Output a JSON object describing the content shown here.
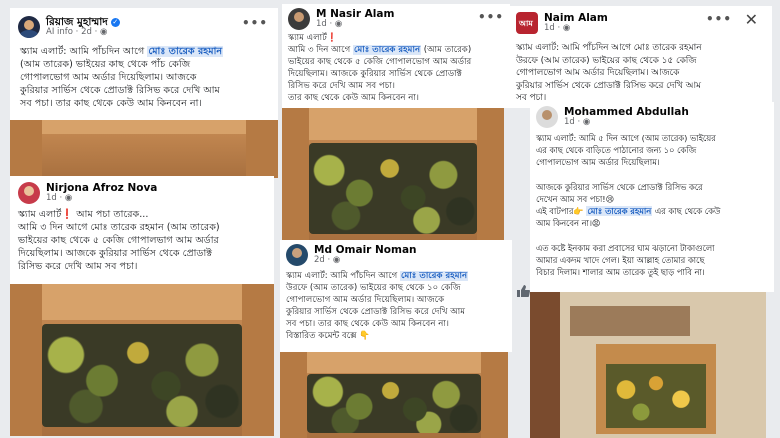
{
  "posts": {
    "p1": {
      "author": "রিয়াজ মুহাম্মাদ",
      "verified": true,
      "source": "AI info",
      "time": "2d",
      "lines": [
        {
          "pre": "স্ক্যাম এলার্ট: আমি পাঁচদিন আগে ",
          "hl": "মোঃ তারেক রহমান",
          "post": ""
        },
        {
          "pre": "(আম তারেক) ভাইয়ের কাছ থেকে পাঁচ কেজি",
          "hl": "",
          "post": ""
        },
        {
          "pre": "গোপালভোগ আম অর্ডার দিয়েছিলাম। আজকে",
          "hl": "",
          "post": ""
        },
        {
          "pre": "কুরিয়ার সার্ভিস থেকে প্রোডাক্ট রিসিভ করে দেখি আম",
          "hl": "",
          "post": ""
        },
        {
          "pre": "সব পচা। তার কাছ থেকে কেউ আম কিনবেন না।",
          "hl": "",
          "post": ""
        }
      ]
    },
    "p2": {
      "author": "Nirjona Afroz Nova",
      "time": "1d",
      "lines": [
        {
          "pre": "স্ক্যাম এলার্ট❗ আম পচা তারেক...",
          "hl": "",
          "post": ""
        },
        {
          "pre": "আমি ৩ দিন আগে মোঃ তারেক রহমান (আম তারেক)",
          "hl": "",
          "post": ""
        },
        {
          "pre": "ভাইয়ের কাছ থেকে ৫ কেজি গোপালভাগ আম অর্ডার",
          "hl": "",
          "post": ""
        },
        {
          "pre": "দিয়েছিলাম। আজকে কুরিয়ার সার্ভিস থেকে প্রোডাক্ট",
          "hl": "",
          "post": ""
        },
        {
          "pre": "রিসিভ করে দেখি আম সব পচা।",
          "hl": "",
          "post": ""
        }
      ]
    },
    "p3": {
      "author": "M Nasir Alam",
      "time": "1d",
      "lines": [
        {
          "pre": "স্ক্যাম এলার্ট❗",
          "hl": "",
          "post": ""
        },
        {
          "pre": "আমি ৩ দিন আগে ",
          "hl": "মোঃ তারেক রহমান",
          "post": " (আম তারেক)"
        },
        {
          "pre": "ভাইয়ের কাছ থেকে ৫ কেজি গোপালভোগ আম অর্ডার",
          "hl": "",
          "post": ""
        },
        {
          "pre": "দিয়েছিলাম। আজকে কুরিয়ার সার্ভিস থেকে প্রোডাক্ট",
          "hl": "",
          "post": ""
        },
        {
          "pre": "রিসিভ করে দেখি আম সব পচা।",
          "hl": "",
          "post": ""
        },
        {
          "pre": "তার কাছ থেকে কেউ আম কিনবেন না।",
          "hl": "",
          "post": ""
        }
      ]
    },
    "p4": {
      "author": "Md Omair Noman",
      "time": "2d",
      "lines": [
        {
          "pre": "স্ক্যাম এলার্ট: আমি পাঁচদিন আগে ",
          "hl": "মোঃ তারেক রহমান",
          "post": ""
        },
        {
          "pre": "উরফে (আম তারেক) ভাইয়ের কাছ থেকে ১০ কেজি",
          "hl": "",
          "post": ""
        },
        {
          "pre": "গোপালভোগ আম অর্ডার দিয়েছিলাম। আজকে",
          "hl": "",
          "post": ""
        },
        {
          "pre": "কুরিয়ার সার্ভিস থেকে প্রোডাক্ট রিসিভ করে দেখি আম",
          "hl": "",
          "post": ""
        },
        {
          "pre": "সব পচা। তার কাছ থেকে কেউ আম কিনবেন না।",
          "hl": "",
          "post": ""
        },
        {
          "pre": "বিস্তারিত কমেন্ট বক্সে 👇",
          "hl": "",
          "post": ""
        }
      ]
    },
    "p5": {
      "author": "Naim Alam",
      "time": "1d",
      "lines": [
        {
          "pre": "স্ক্যাম এলার্ট: আমি পাঁচদিন আগে মোঃ তারেক রহমান",
          "hl": "",
          "post": ""
        },
        {
          "pre": "উরফে (আম তারেক) ভাইয়ের কাছ থেকে ১৫ কেজি",
          "hl": "",
          "post": ""
        },
        {
          "pre": "গোপালভোগ আম অর্ডার দিয়েছিলাম। আজকে",
          "hl": "",
          "post": ""
        },
        {
          "pre": "কুরিয়ার সার্ভিস থেকে প্রোডাক্ট রিসিভ করে দেখি আম",
          "hl": "",
          "post": ""
        },
        {
          "pre": "সব পচা।",
          "hl": "",
          "post": ""
        }
      ]
    },
    "p6": {
      "author": "Mohammed Abdullah",
      "time": "1d",
      "lines": [
        {
          "pre": "স্ক্যাম এলার্ট: আমি ৫ দিন আগে (আম তারেক) ভাইয়ের",
          "hl": "",
          "post": ""
        },
        {
          "pre": "এর কাছ থেকে বাড়িতে পাঠানোর জন্য ১০ কেজি",
          "hl": "",
          "post": ""
        },
        {
          "pre": "গোপালভোগ আম অর্ডার দিয়েছিলাম।",
          "hl": "",
          "post": ""
        },
        {
          "pre": "",
          "hl": "",
          "post": ""
        },
        {
          "pre": "আজকে কুরিয়ার সার্ভিস থেকে প্রোডাক্ট রিসিভ করে",
          "hl": "",
          "post": ""
        },
        {
          "pre": "দেখেন আম সব পচা!😢",
          "hl": "",
          "post": ""
        },
        {
          "pre": "এই বাটপার👉 ",
          "hl": "মোঃ তারেক রহমান",
          "post": " এর কাছ থেকে কেউ"
        },
        {
          "pre": "আম কিনবেন না।😡",
          "hl": "",
          "post": ""
        },
        {
          "pre": "",
          "hl": "",
          "post": ""
        },
        {
          "pre": "এত কষ্টে ইনকাম করা প্রবাসের ঘাম ঝড়ানো টাকাগুলো",
          "hl": "",
          "post": ""
        },
        {
          "pre": "আমার একদম খাদে গেল। ইয়া আল্লাহ তোমার কাছে",
          "hl": "",
          "post": ""
        },
        {
          "pre": "বিচার দিলাম। শালার আম তারেক তুই ছাড় পাবি না।",
          "hl": "",
          "post": ""
        }
      ]
    }
  },
  "ui": {
    "more": "•••",
    "close": "✕",
    "verified_mark": "✓",
    "alert_mark": "❗"
  },
  "colors": {
    "fb_blue": "#1877f2",
    "highlight_bg": "#dbe7f8",
    "highlight_fg": "#1b5fc1",
    "frame_red": "#d62b2b"
  }
}
